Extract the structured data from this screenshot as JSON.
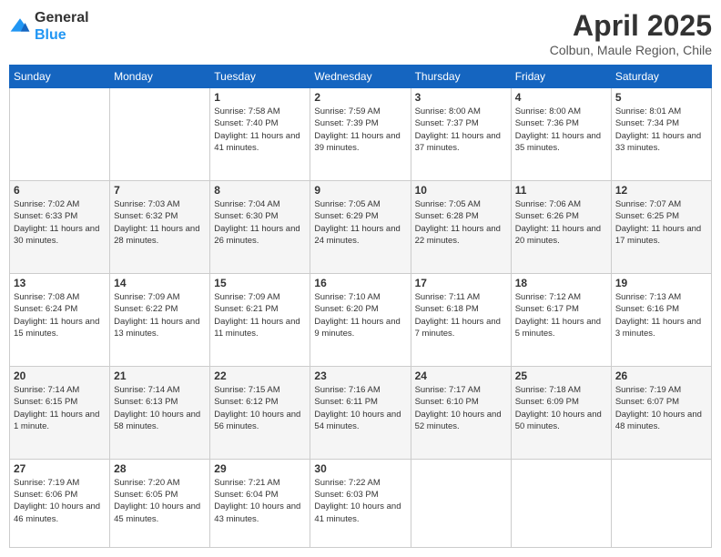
{
  "header": {
    "logo_general": "General",
    "logo_blue": "Blue",
    "month_title": "April 2025",
    "location": "Colbun, Maule Region, Chile"
  },
  "weekdays": [
    "Sunday",
    "Monday",
    "Tuesday",
    "Wednesday",
    "Thursday",
    "Friday",
    "Saturday"
  ],
  "weeks": [
    [
      {
        "day": "",
        "sunrise": "",
        "sunset": "",
        "daylight": ""
      },
      {
        "day": "",
        "sunrise": "",
        "sunset": "",
        "daylight": ""
      },
      {
        "day": "1",
        "sunrise": "Sunrise: 7:58 AM",
        "sunset": "Sunset: 7:40 PM",
        "daylight": "Daylight: 11 hours and 41 minutes."
      },
      {
        "day": "2",
        "sunrise": "Sunrise: 7:59 AM",
        "sunset": "Sunset: 7:39 PM",
        "daylight": "Daylight: 11 hours and 39 minutes."
      },
      {
        "day": "3",
        "sunrise": "Sunrise: 8:00 AM",
        "sunset": "Sunset: 7:37 PM",
        "daylight": "Daylight: 11 hours and 37 minutes."
      },
      {
        "day": "4",
        "sunrise": "Sunrise: 8:00 AM",
        "sunset": "Sunset: 7:36 PM",
        "daylight": "Daylight: 11 hours and 35 minutes."
      },
      {
        "day": "5",
        "sunrise": "Sunrise: 8:01 AM",
        "sunset": "Sunset: 7:34 PM",
        "daylight": "Daylight: 11 hours and 33 minutes."
      }
    ],
    [
      {
        "day": "6",
        "sunrise": "Sunrise: 7:02 AM",
        "sunset": "Sunset: 6:33 PM",
        "daylight": "Daylight: 11 hours and 30 minutes."
      },
      {
        "day": "7",
        "sunrise": "Sunrise: 7:03 AM",
        "sunset": "Sunset: 6:32 PM",
        "daylight": "Daylight: 11 hours and 28 minutes."
      },
      {
        "day": "8",
        "sunrise": "Sunrise: 7:04 AM",
        "sunset": "Sunset: 6:30 PM",
        "daylight": "Daylight: 11 hours and 26 minutes."
      },
      {
        "day": "9",
        "sunrise": "Sunrise: 7:05 AM",
        "sunset": "Sunset: 6:29 PM",
        "daylight": "Daylight: 11 hours and 24 minutes."
      },
      {
        "day": "10",
        "sunrise": "Sunrise: 7:05 AM",
        "sunset": "Sunset: 6:28 PM",
        "daylight": "Daylight: 11 hours and 22 minutes."
      },
      {
        "day": "11",
        "sunrise": "Sunrise: 7:06 AM",
        "sunset": "Sunset: 6:26 PM",
        "daylight": "Daylight: 11 hours and 20 minutes."
      },
      {
        "day": "12",
        "sunrise": "Sunrise: 7:07 AM",
        "sunset": "Sunset: 6:25 PM",
        "daylight": "Daylight: 11 hours and 17 minutes."
      }
    ],
    [
      {
        "day": "13",
        "sunrise": "Sunrise: 7:08 AM",
        "sunset": "Sunset: 6:24 PM",
        "daylight": "Daylight: 11 hours and 15 minutes."
      },
      {
        "day": "14",
        "sunrise": "Sunrise: 7:09 AM",
        "sunset": "Sunset: 6:22 PM",
        "daylight": "Daylight: 11 hours and 13 minutes."
      },
      {
        "day": "15",
        "sunrise": "Sunrise: 7:09 AM",
        "sunset": "Sunset: 6:21 PM",
        "daylight": "Daylight: 11 hours and 11 minutes."
      },
      {
        "day": "16",
        "sunrise": "Sunrise: 7:10 AM",
        "sunset": "Sunset: 6:20 PM",
        "daylight": "Daylight: 11 hours and 9 minutes."
      },
      {
        "day": "17",
        "sunrise": "Sunrise: 7:11 AM",
        "sunset": "Sunset: 6:18 PM",
        "daylight": "Daylight: 11 hours and 7 minutes."
      },
      {
        "day": "18",
        "sunrise": "Sunrise: 7:12 AM",
        "sunset": "Sunset: 6:17 PM",
        "daylight": "Daylight: 11 hours and 5 minutes."
      },
      {
        "day": "19",
        "sunrise": "Sunrise: 7:13 AM",
        "sunset": "Sunset: 6:16 PM",
        "daylight": "Daylight: 11 hours and 3 minutes."
      }
    ],
    [
      {
        "day": "20",
        "sunrise": "Sunrise: 7:14 AM",
        "sunset": "Sunset: 6:15 PM",
        "daylight": "Daylight: 11 hours and 1 minute."
      },
      {
        "day": "21",
        "sunrise": "Sunrise: 7:14 AM",
        "sunset": "Sunset: 6:13 PM",
        "daylight": "Daylight: 10 hours and 58 minutes."
      },
      {
        "day": "22",
        "sunrise": "Sunrise: 7:15 AM",
        "sunset": "Sunset: 6:12 PM",
        "daylight": "Daylight: 10 hours and 56 minutes."
      },
      {
        "day": "23",
        "sunrise": "Sunrise: 7:16 AM",
        "sunset": "Sunset: 6:11 PM",
        "daylight": "Daylight: 10 hours and 54 minutes."
      },
      {
        "day": "24",
        "sunrise": "Sunrise: 7:17 AM",
        "sunset": "Sunset: 6:10 PM",
        "daylight": "Daylight: 10 hours and 52 minutes."
      },
      {
        "day": "25",
        "sunrise": "Sunrise: 7:18 AM",
        "sunset": "Sunset: 6:09 PM",
        "daylight": "Daylight: 10 hours and 50 minutes."
      },
      {
        "day": "26",
        "sunrise": "Sunrise: 7:19 AM",
        "sunset": "Sunset: 6:07 PM",
        "daylight": "Daylight: 10 hours and 48 minutes."
      }
    ],
    [
      {
        "day": "27",
        "sunrise": "Sunrise: 7:19 AM",
        "sunset": "Sunset: 6:06 PM",
        "daylight": "Daylight: 10 hours and 46 minutes."
      },
      {
        "day": "28",
        "sunrise": "Sunrise: 7:20 AM",
        "sunset": "Sunset: 6:05 PM",
        "daylight": "Daylight: 10 hours and 45 minutes."
      },
      {
        "day": "29",
        "sunrise": "Sunrise: 7:21 AM",
        "sunset": "Sunset: 6:04 PM",
        "daylight": "Daylight: 10 hours and 43 minutes."
      },
      {
        "day": "30",
        "sunrise": "Sunrise: 7:22 AM",
        "sunset": "Sunset: 6:03 PM",
        "daylight": "Daylight: 10 hours and 41 minutes."
      },
      {
        "day": "",
        "sunrise": "",
        "sunset": "",
        "daylight": ""
      },
      {
        "day": "",
        "sunrise": "",
        "sunset": "",
        "daylight": ""
      },
      {
        "day": "",
        "sunrise": "",
        "sunset": "",
        "daylight": ""
      }
    ]
  ]
}
